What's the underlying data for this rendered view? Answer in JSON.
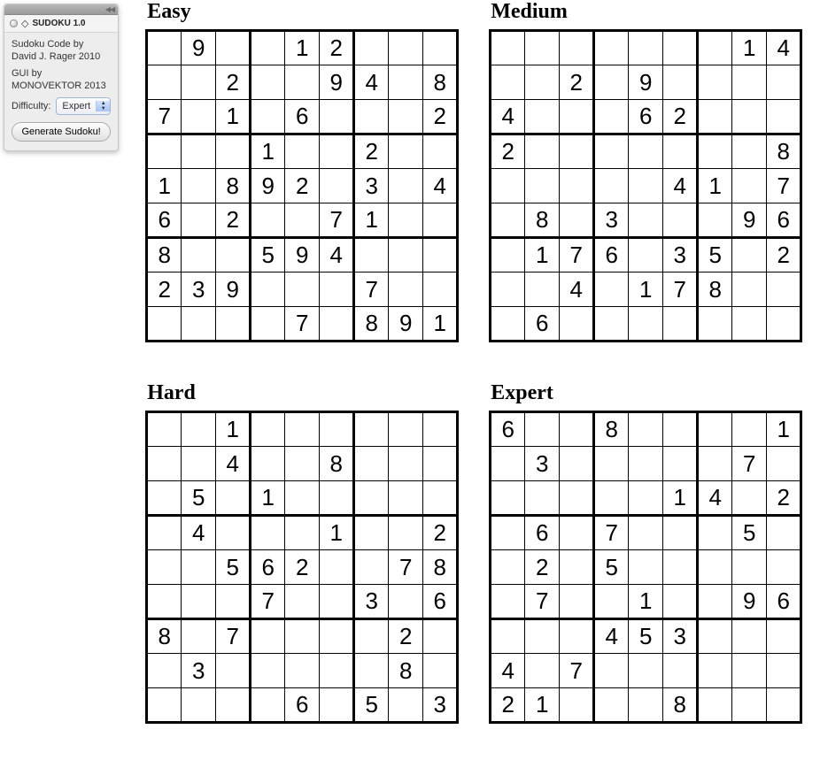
{
  "panel": {
    "app_title": "SUDOKU 1.0",
    "credit_line1": "Sudoku Code by",
    "credit_line2": "David J. Rager 2010",
    "credit_line3": "GUI by MONOVEKTOR 2013",
    "difficulty_label": "Difficulty:",
    "difficulty_value": "Expert",
    "generate_label": "Generate Sudoku!"
  },
  "puzzles": [
    {
      "title": "Easy",
      "grid": [
        [
          "",
          "9",
          "",
          "",
          "1",
          "2",
          "",
          "",
          ""
        ],
        [
          "",
          "",
          "2",
          "",
          "",
          "9",
          "4",
          "",
          "8"
        ],
        [
          "7",
          "",
          "1",
          "",
          "6",
          "",
          "",
          "",
          "2"
        ],
        [
          "",
          "",
          "",
          "1",
          "",
          "",
          "2",
          "",
          ""
        ],
        [
          "1",
          "",
          "8",
          "9",
          "2",
          "",
          "3",
          "",
          "4"
        ],
        [
          "6",
          "",
          "2",
          "",
          "",
          "7",
          "1",
          "",
          ""
        ],
        [
          "8",
          "",
          "",
          "5",
          "9",
          "4",
          "",
          "",
          ""
        ],
        [
          "2",
          "3",
          "9",
          "",
          "",
          "",
          "7",
          "",
          ""
        ],
        [
          "",
          "",
          "",
          "",
          "7",
          "",
          "8",
          "9",
          "1"
        ]
      ]
    },
    {
      "title": "Medium",
      "grid": [
        [
          "",
          "",
          "",
          "",
          "",
          "",
          "",
          "1",
          "4"
        ],
        [
          "",
          "",
          "2",
          "",
          "9",
          "",
          "",
          "",
          ""
        ],
        [
          "4",
          "",
          "",
          "",
          "6",
          "2",
          "",
          "",
          ""
        ],
        [
          "2",
          "",
          "",
          "",
          "",
          "",
          "",
          "",
          "8"
        ],
        [
          "",
          "",
          "",
          "",
          "",
          "4",
          "1",
          "",
          "7"
        ],
        [
          "",
          "8",
          "",
          "3",
          "",
          "",
          "",
          "9",
          "6"
        ],
        [
          "",
          "1",
          "7",
          "6",
          "",
          "3",
          "5",
          "",
          "2"
        ],
        [
          "",
          "",
          "4",
          "",
          "1",
          "7",
          "8",
          "",
          ""
        ],
        [
          "",
          "6",
          "",
          "",
          "",
          "",
          "",
          "",
          ""
        ]
      ]
    },
    {
      "title": "Hard",
      "grid": [
        [
          "",
          "",
          "1",
          "",
          "",
          "",
          "",
          "",
          ""
        ],
        [
          "",
          "",
          "4",
          "",
          "",
          "8",
          "",
          "",
          ""
        ],
        [
          "",
          "5",
          "",
          "1",
          "",
          "",
          "",
          "",
          ""
        ],
        [
          "",
          "4",
          "",
          "",
          "",
          "1",
          "",
          "",
          "2"
        ],
        [
          "",
          "",
          "5",
          "6",
          "2",
          "",
          "",
          "7",
          "8"
        ],
        [
          "",
          "",
          "",
          "7",
          "",
          "",
          "3",
          "",
          "6"
        ],
        [
          "8",
          "",
          "7",
          "",
          "",
          "",
          "",
          "2",
          ""
        ],
        [
          "",
          "3",
          "",
          "",
          "",
          "",
          "",
          "8",
          ""
        ],
        [
          "",
          "",
          "",
          "",
          "6",
          "",
          "5",
          "",
          "3"
        ]
      ]
    },
    {
      "title": "Expert",
      "grid": [
        [
          "6",
          "",
          "",
          "8",
          "",
          "",
          "",
          "",
          "1"
        ],
        [
          "",
          "3",
          "",
          "",
          "",
          "",
          "",
          "7",
          ""
        ],
        [
          "",
          "",
          "",
          "",
          "",
          "1",
          "4",
          "",
          "2"
        ],
        [
          "",
          "6",
          "",
          "7",
          "",
          "",
          "",
          "5",
          ""
        ],
        [
          "",
          "2",
          "",
          "5",
          "",
          "",
          "",
          "",
          ""
        ],
        [
          "",
          "7",
          "",
          "",
          "1",
          "",
          "",
          "9",
          "6"
        ],
        [
          "",
          "",
          "",
          "4",
          "5",
          "3",
          "",
          "",
          ""
        ],
        [
          "4",
          "",
          "7",
          "",
          "",
          "",
          "",
          "",
          ""
        ],
        [
          "2",
          "1",
          "",
          "",
          "",
          "8",
          "",
          "",
          ""
        ]
      ]
    }
  ]
}
